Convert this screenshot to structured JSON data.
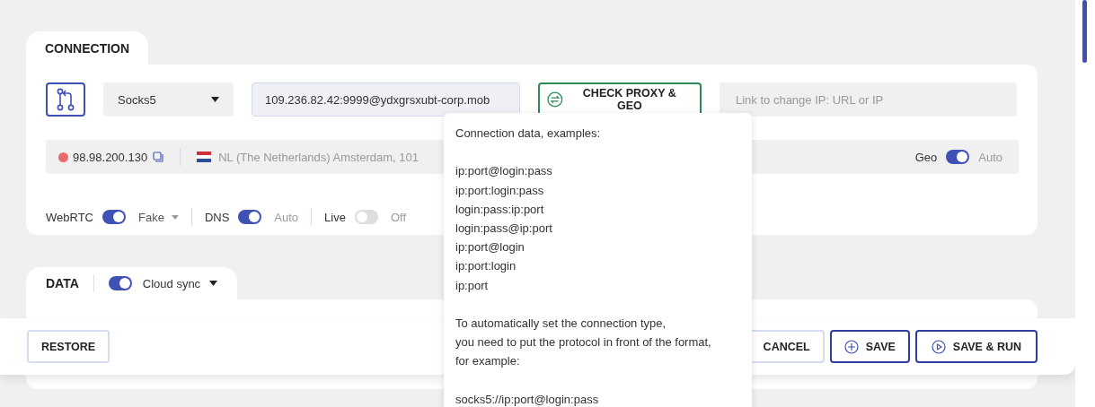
{
  "connection": {
    "title": "CONNECTION",
    "proxy_type": "Socks5",
    "proxy_value": "109.236.82.42:9999@ydxgrsxubt-corp.mob",
    "check_button": "CHECK PROXY & GEO",
    "change_ip_placeholder": "Link to change IP: URL or IP",
    "ip": {
      "address": "98.98.200.130",
      "color": "#e86a6a"
    },
    "location": "NL (The Netherlands) Amsterdam, 101",
    "geo": {
      "label": "Geo",
      "on": true,
      "value": "Auto"
    },
    "options": [
      {
        "kind": "dropdown",
        "label": "WebRTC",
        "on": true,
        "value": "Fake"
      },
      {
        "kind": "plain",
        "label": "DNS",
        "on": true,
        "value": "Auto"
      },
      {
        "kind": "plain",
        "label": "Live",
        "on": false,
        "value": "Off"
      }
    ]
  },
  "data": {
    "title": "DATA",
    "cloud_sync": {
      "label": "Cloud sync",
      "on": true
    }
  },
  "footer": {
    "restore": "RESTORE",
    "cancel": "CANCEL",
    "save": "SAVE",
    "save_run": "SAVE & RUN"
  },
  "tooltip": {
    "paragraphs": [
      [
        "Connection data, examples:"
      ],
      [
        "ip:port@login:pass",
        "ip:port:login:pass",
        "login:pass:ip:port",
        "login:pass@ip:port",
        "ip:port@login",
        "ip:port:login",
        "ip:port"
      ],
      [
        "To automatically set the connection type,",
        "you need to put the protocol in front of the format,",
        "for example:"
      ],
      [
        "socks5://ip:port@login:pass"
      ]
    ]
  }
}
